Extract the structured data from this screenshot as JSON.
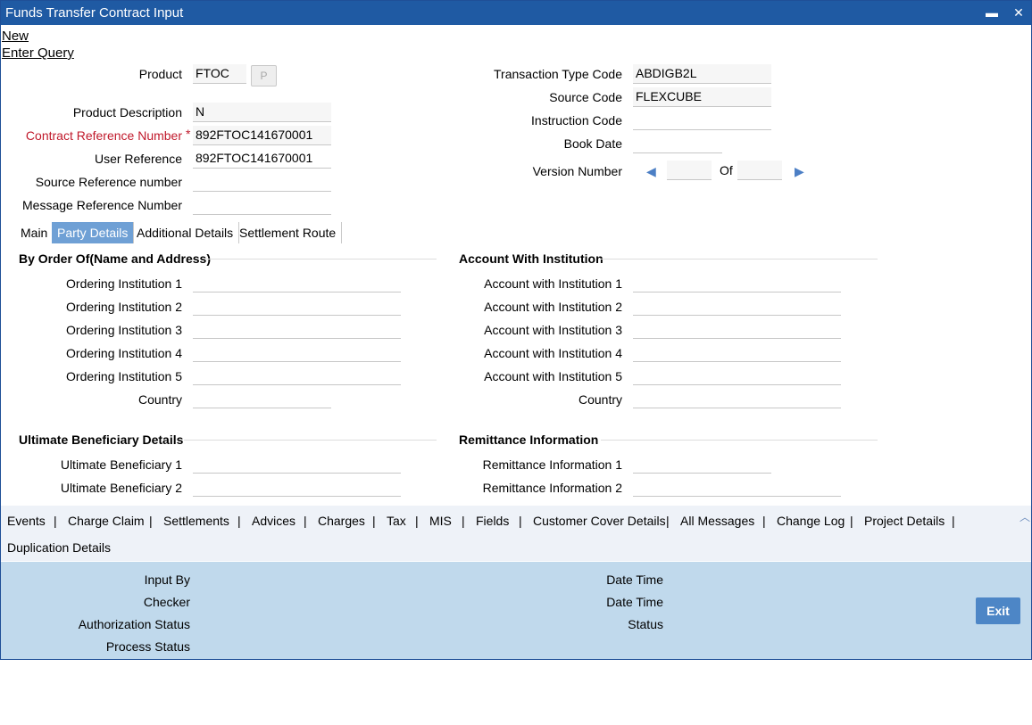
{
  "window": {
    "title": "Funds Transfer Contract Input",
    "minimize": "▬",
    "close": "✕"
  },
  "actions": {
    "new": "New",
    "enter_query": "Enter Query"
  },
  "header": {
    "product": {
      "label": "Product",
      "value": "FTOC",
      "button": "P"
    },
    "product_description": {
      "label": "Product Description",
      "value": "N"
    },
    "contract_reference": {
      "label": "Contract Reference Number",
      "required": "*",
      "value": "892FTOC141670001"
    },
    "user_reference": {
      "label": "User Reference",
      "value": "892FTOC141670001"
    },
    "source_reference": {
      "label": "Source Reference number",
      "value": ""
    },
    "message_reference": {
      "label": "Message Reference Number",
      "value": ""
    },
    "transaction_type_code": {
      "label": "Transaction Type Code",
      "value": "ABDIGB2L"
    },
    "source_code": {
      "label": "Source Code",
      "value": "FLEXCUBE"
    },
    "instruction_code": {
      "label": "Instruction Code",
      "value": ""
    },
    "book_date": {
      "label": "Book Date",
      "value": ""
    },
    "version": {
      "label": "Version Number",
      "of_label": "Of",
      "current": "",
      "total": ""
    }
  },
  "tabs": [
    "Main",
    "Party Details",
    "Additional Details",
    "Settlement Route"
  ],
  "active_tab": "Party Details",
  "by_order_of": {
    "title": "By Order Of(Name and Address)",
    "fields": [
      "Ordering Institution 1",
      "Ordering Institution 2",
      "Ordering Institution 3",
      "Ordering Institution 4",
      "Ordering Institution 5",
      "Country"
    ]
  },
  "account_with_institution": {
    "title": "Account With Institution",
    "fields": [
      "Account with Institution 1",
      "Account with Institution 2",
      "Account with Institution 3",
      "Account with Institution 4",
      "Account with Institution 5",
      "Country"
    ]
  },
  "ultimate_beneficiary": {
    "title": "Ultimate Beneficiary Details",
    "fields": [
      "Ultimate Beneficiary 1",
      "Ultimate Beneficiary 2"
    ]
  },
  "remittance": {
    "title": "Remittance Information",
    "fields": [
      "Remittance Information 1",
      "Remittance Information 2"
    ]
  },
  "bottom_links": [
    "Events",
    "Charge Claim",
    "Settlements",
    "Advices",
    "Charges",
    "Tax",
    "MIS",
    "Fields",
    "Customer Cover Details",
    "All Messages",
    "Change Log",
    "Project Details",
    "Duplication Details"
  ],
  "footer": {
    "input_by": "Input By",
    "checker": "Checker",
    "authorization_status": "Authorization Status",
    "process_status": "Process Status",
    "date_time_1": "Date Time",
    "date_time_2": "Date Time",
    "status": "Status",
    "exit": "Exit"
  }
}
